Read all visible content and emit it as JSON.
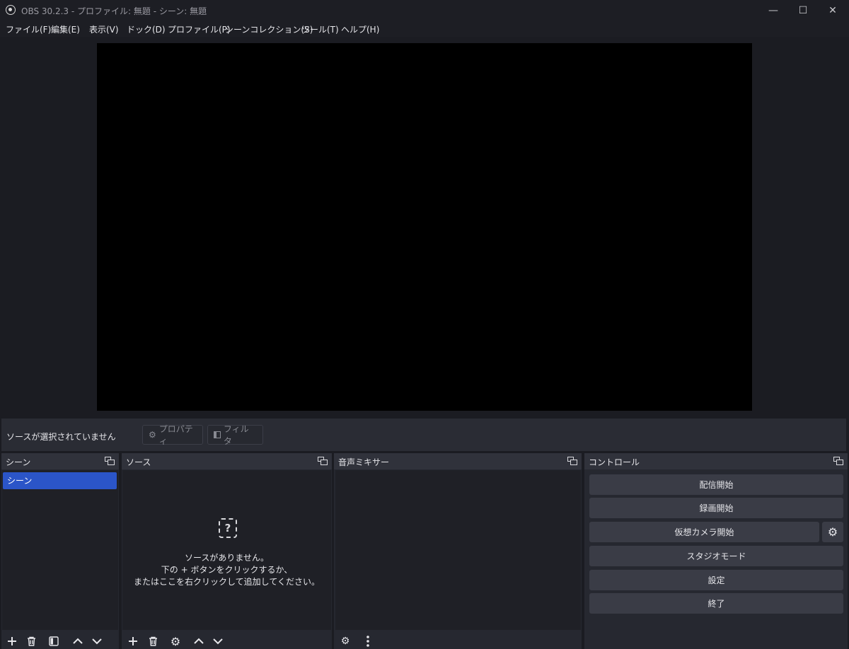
{
  "window": {
    "title": "OBS 30.2.3 - プロファイル: 無題 - シーン: 無題",
    "minimize": "—",
    "maximize": "☐",
    "close": "✕"
  },
  "menu": [
    "ファイル(F)",
    "編集(E)",
    "表示(V)",
    "ドック(D)",
    "プロファイル(P)",
    "シーンコレクション(S)",
    "ツール(T)",
    "ヘルプ(H)"
  ],
  "context_bar": {
    "no_source": "ソースが選択されていません",
    "properties": "プロパティ",
    "filters": "フィルタ"
  },
  "docks": {
    "scenes": {
      "title": "シーン",
      "items": [
        "シーン"
      ],
      "selected": 0
    },
    "sources": {
      "title": "ソース",
      "empty_line1": "ソースがありません。",
      "empty_line2": "下の + ボタンをクリックするか、",
      "empty_line3": "またはここを右クリックして追加してください。"
    },
    "mixer": {
      "title": "音声ミキサー"
    },
    "controls": {
      "title": "コントロール",
      "start_streaming": "配信開始",
      "start_recording": "録画開始",
      "start_virtual_cam": "仮想カメラ開始",
      "studio_mode": "スタジオモード",
      "settings": "設定",
      "exit": "終了"
    }
  },
  "colors": {
    "accent_selected": "#2b55c8",
    "panel": "#262830",
    "button": "#3a3c46"
  }
}
